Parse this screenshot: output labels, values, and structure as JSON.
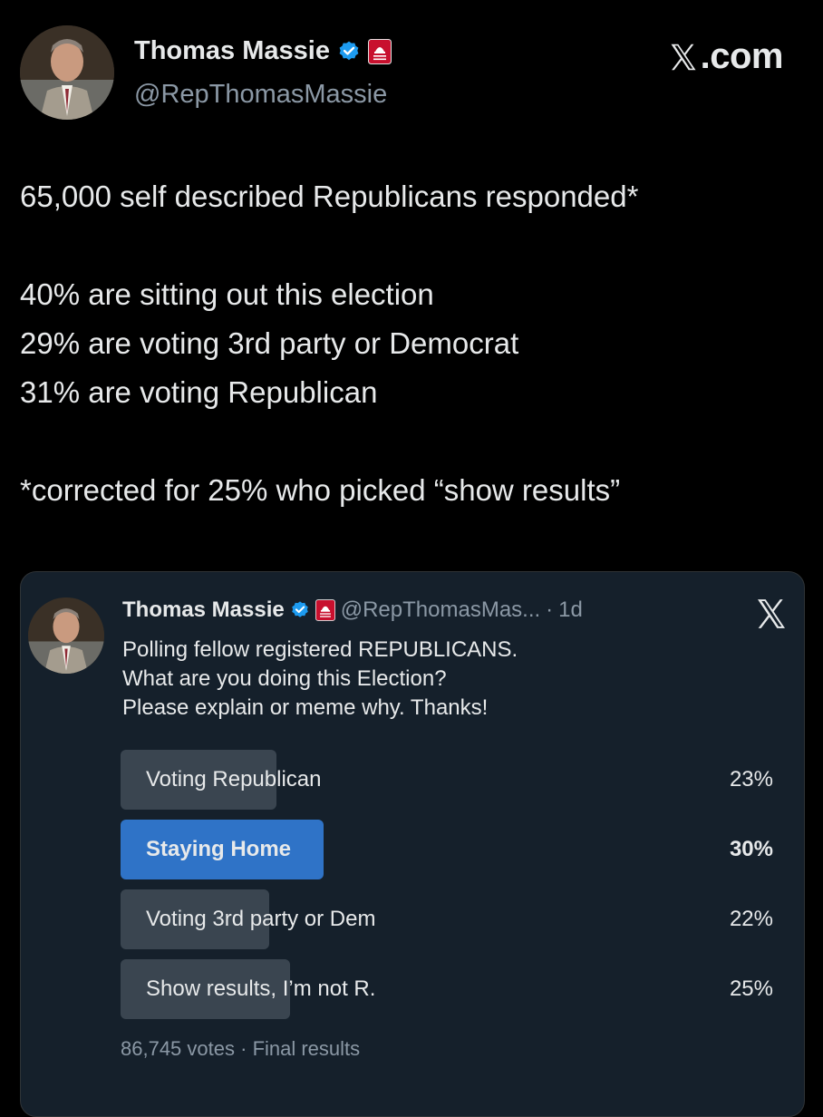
{
  "tweet": {
    "author_name": "Thomas Massie",
    "author_handle": "@RepThomasMassie",
    "brand": ".com",
    "brand_icon": "x-logo-icon",
    "lines": [
      "65,000 self described Republicans responded*",
      "40% are sitting out this election",
      "29% are voting 3rd party or Democrat",
      "31%  are voting Republican",
      "*corrected for 25% who picked “show results”"
    ]
  },
  "quoted": {
    "author_name": "Thomas Massie",
    "author_handle": "@RepThomasMas...",
    "separator": "·",
    "time": "1d",
    "lines": [
      "Polling fellow registered REPUBLICANS.",
      "What are you doing this Election?",
      "Please explain or meme why. Thanks!"
    ],
    "poll": {
      "options": [
        {
          "label": "Voting Republican",
          "percent_text": "23%",
          "percent": 23,
          "winner": false
        },
        {
          "label": "Staying Home",
          "percent_text": "30%",
          "percent": 30,
          "winner": true
        },
        {
          "label": "Voting 3rd party or Dem",
          "percent_text": "22%",
          "percent": 22,
          "winner": false
        },
        {
          "label": "Show results, I’m not R.",
          "percent_text": "25%",
          "percent": 25,
          "winner": false
        }
      ],
      "votes": "86,745 votes",
      "separator": "·",
      "status": "Final results"
    }
  },
  "colors": {
    "background": "#000000",
    "card_background": "#15202b",
    "poll_bar": "#3a4550",
    "poll_bar_winner": "#2f73c7",
    "verified": "#1d9bf0",
    "gop_badge": "#c8102e"
  }
}
